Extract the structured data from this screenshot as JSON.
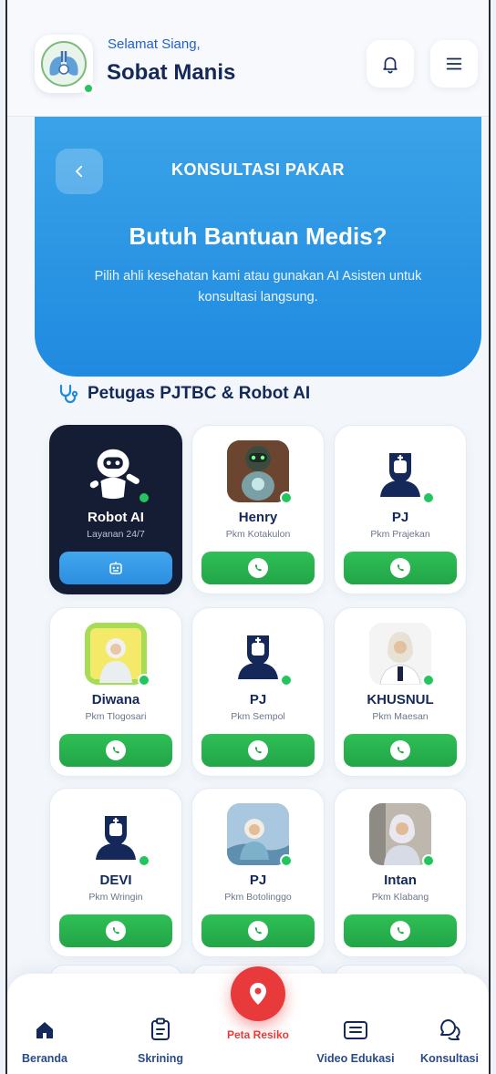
{
  "header": {
    "greeting": "Selamat Siang,",
    "username": "Sobat Manis"
  },
  "hero": {
    "title": "KONSULTASI PAKAR",
    "headline": "Butuh Bantuan Medis?",
    "description": "Pilih ahli kesehatan kami atau gunakan AI Asisten untuk konsultasi langsung."
  },
  "section": {
    "title": "Petugas PJTBC & Robot AI"
  },
  "cards": [
    {
      "name": "Robot AI",
      "subtitle": "Layanan 24/7",
      "avatar": "robot-icon",
      "button": "robot-chat"
    },
    {
      "name": "Henry",
      "subtitle": "Pkm Kotakulon",
      "avatar": "robot-photo",
      "button": "whatsapp"
    },
    {
      "name": "PJ",
      "subtitle": "Pkm Prajekan",
      "avatar": "nurse-icon",
      "button": "whatsapp"
    },
    {
      "name": "Diwana",
      "subtitle": "Pkm Tlogosari",
      "avatar": "person-photo",
      "button": "whatsapp"
    },
    {
      "name": "PJ",
      "subtitle": "Pkm Sempol",
      "avatar": "nurse-icon",
      "button": "whatsapp"
    },
    {
      "name": "KHUSNUL",
      "subtitle": "Pkm Maesan",
      "avatar": "person-photo",
      "button": "whatsapp"
    },
    {
      "name": "DEVI",
      "subtitle": "Pkm Wringin",
      "avatar": "nurse-icon",
      "button": "whatsapp"
    },
    {
      "name": "PJ",
      "subtitle": "Pkm Botolinggo",
      "avatar": "person-photo",
      "button": "whatsapp"
    },
    {
      "name": "Intan",
      "subtitle": "Pkm Klabang",
      "avatar": "person-photo",
      "button": "whatsapp"
    }
  ],
  "nav": {
    "items": [
      {
        "label": "Beranda",
        "icon": "home-icon"
      },
      {
        "label": "Skrining",
        "icon": "clipboard-icon"
      },
      {
        "label": "Peta Resiko",
        "icon": "map-pin-icon"
      },
      {
        "label": "Video Edukasi",
        "icon": "video-list-icon"
      },
      {
        "label": "Konsultasi",
        "icon": "chat-icon"
      }
    ]
  },
  "colors": {
    "primary": "#1f8ae0",
    "navy": "#14295a",
    "green": "#22a548",
    "red": "#e83a3a",
    "online": "#22c55e"
  }
}
